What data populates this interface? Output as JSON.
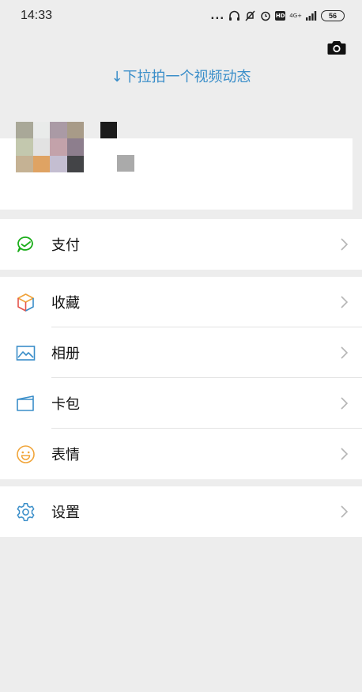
{
  "status_bar": {
    "time": "14:33",
    "dots": "...",
    "hd": "HD",
    "network": "4G+",
    "battery": "56"
  },
  "header": {
    "pull_hint": "↓下拉拍一个视频动态"
  },
  "menu": {
    "pay": {
      "label": "支付"
    },
    "favorites": {
      "label": "收藏"
    },
    "album": {
      "label": "相册"
    },
    "cards": {
      "label": "卡包"
    },
    "stickers": {
      "label": "表情"
    },
    "settings": {
      "label": "设置"
    }
  },
  "colors": {
    "background": "#ededed",
    "accent_blue": "#3a8ec9",
    "wechat_green": "#1aad19",
    "stickers_yellow": "#f1a53a"
  },
  "avatar_mosaic": [
    "#a9a898",
    "#e9ebea",
    "#aa9aa5",
    "#a89b88",
    "#c3c8ae",
    "#e2e2e2",
    "#c3a2aa",
    "#8d7e8d",
    "#c5b294",
    "#dfa363",
    "#c4bed1",
    "#434447"
  ]
}
